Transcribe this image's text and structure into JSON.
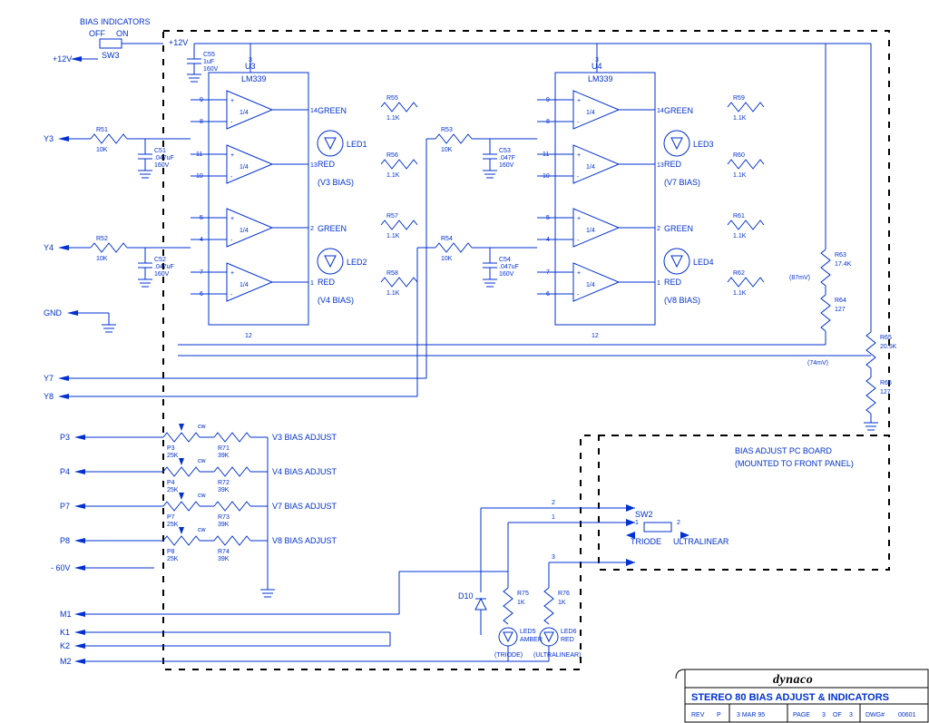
{
  "header": {
    "bias_ind_label": "BIAS INDICATORS",
    "off": "OFF",
    "on": "ON",
    "sw3": "SW3",
    "p12v": "+12V"
  },
  "voltageRefs": {
    "87mv": "(87mV)",
    "74mv": "(74mV)"
  },
  "comparatorBlock": {
    "part": "LM339",
    "pins": {
      "p1": "1",
      "p2": "2",
      "p3": "3",
      "p4": "4",
      "p5": "5",
      "p6": "6",
      "p7": "7",
      "p8": "8",
      "p9": "9",
      "p10": "10",
      "p11": "11",
      "p12": "12",
      "p13": "13",
      "p14": "14"
    },
    "sub": "1/4"
  },
  "blocks": {
    "u3": {
      "ref": "U3",
      "led_top": "LED1",
      "led_bot": "LED2",
      "bias_top": "(V3 BIAS)",
      "bias_bot": "(V4 BIAS)",
      "r_top": "R55",
      "r_top2": "R56",
      "r_bot": "R57",
      "r_bot2": "R58"
    },
    "u4": {
      "ref": "U4",
      "led_top": "LED3",
      "led_bot": "LED4",
      "bias_top": "(V7 BIAS)",
      "bias_bot": "(V8 BIAS)",
      "r_top": "R59",
      "r_top2": "R60",
      "r_bot": "R61",
      "r_bot2": "R62"
    }
  },
  "inputs": {
    "y3": "Y3",
    "y4": "Y4",
    "gnd": "GND",
    "y7": "Y7",
    "y8": "Y8",
    "p3": "P3",
    "p4": "P4",
    "p7": "P7",
    "p8": "P8",
    "neg60": "- 60V",
    "m1": "M1",
    "k1": "K1",
    "k2": "K2",
    "m2": "M2"
  },
  "leftStage": {
    "r51": {
      "ref": "R51",
      "val": "10K"
    },
    "r52": {
      "ref": "R52",
      "val": "10K"
    },
    "c51": {
      "ref": "C51",
      "val": ".047uF",
      "volt": "160V"
    },
    "c52": {
      "ref": "C52",
      "val": ".047uF",
      "volt": "160V"
    },
    "c55": {
      "ref": "C55",
      "val": "1uF",
      "volt": "160V"
    },
    "r53": {
      "ref": "R53",
      "val": "10K"
    },
    "r54": {
      "ref": "R54",
      "val": "10K"
    },
    "c53": {
      "ref": "C53",
      "val": ".047F",
      "volt": "160V"
    },
    "c54": {
      "ref": "C54",
      "val": ".047uF",
      "volt": "160V"
    }
  },
  "resVals": {
    "k11": "1.1K"
  },
  "ledColors": {
    "green": "GREEN",
    "red": "RED",
    "amber": "AMBER"
  },
  "divider": {
    "r63": {
      "ref": "R63",
      "val": "17.4K"
    },
    "r64": {
      "ref": "R64",
      "val": "127"
    },
    "r65": {
      "ref": "R65",
      "val": "20.5K"
    },
    "r66": {
      "ref": "R66",
      "val": "127"
    }
  },
  "pots": [
    {
      "pot": "P3",
      "potval": "25K",
      "r": "R71",
      "rv": "39K",
      "label": "V3 BIAS ADJUST"
    },
    {
      "pot": "P4",
      "potval": "25K",
      "r": "R72",
      "rv": "39K",
      "label": "V4 BIAS ADJUST"
    },
    {
      "pot": "P7",
      "potval": "25K",
      "r": "R73",
      "rv": "39K",
      "label": "V7 BIAS ADJUST"
    },
    {
      "pot": "P8",
      "potval": "25K",
      "r": "R74",
      "rv": "39K",
      "label": "V8 BIAS ADJUST"
    }
  ],
  "sw2": {
    "ref": "SW2",
    "triode": "TRIODE",
    "ultra": "ULTRALINEAR",
    "n1": "1",
    "n2": "2",
    "n3": "3"
  },
  "modeLeds": {
    "d10": "D10",
    "r75": {
      "ref": "R75",
      "val": "1K"
    },
    "r76": {
      "ref": "R76",
      "val": "1K"
    },
    "led5": {
      "ref": "LED5",
      "color": "AMBER",
      "label": "(TRIODE)"
    },
    "led6": {
      "ref": "LED6",
      "color": "RED",
      "label": "(ULTRALINEAR)"
    }
  },
  "board2": {
    "title": "BIAS ADJUST PC BOARD",
    "sub": "(MOUNTED TO FRONT PANEL)"
  },
  "cw": "cw",
  "titleBlock": {
    "logo": "dynaco",
    "title": "STEREO 80  BIAS ADJUST & INDICATORS",
    "rev_l": "REV",
    "rev_v": "P",
    "date": "3 MAR 95",
    "page_l": "PAGE",
    "page_n": "3",
    "of": "OF",
    "tot": "3",
    "dwg_l": "DWG#",
    "dwg_n": "00601"
  }
}
